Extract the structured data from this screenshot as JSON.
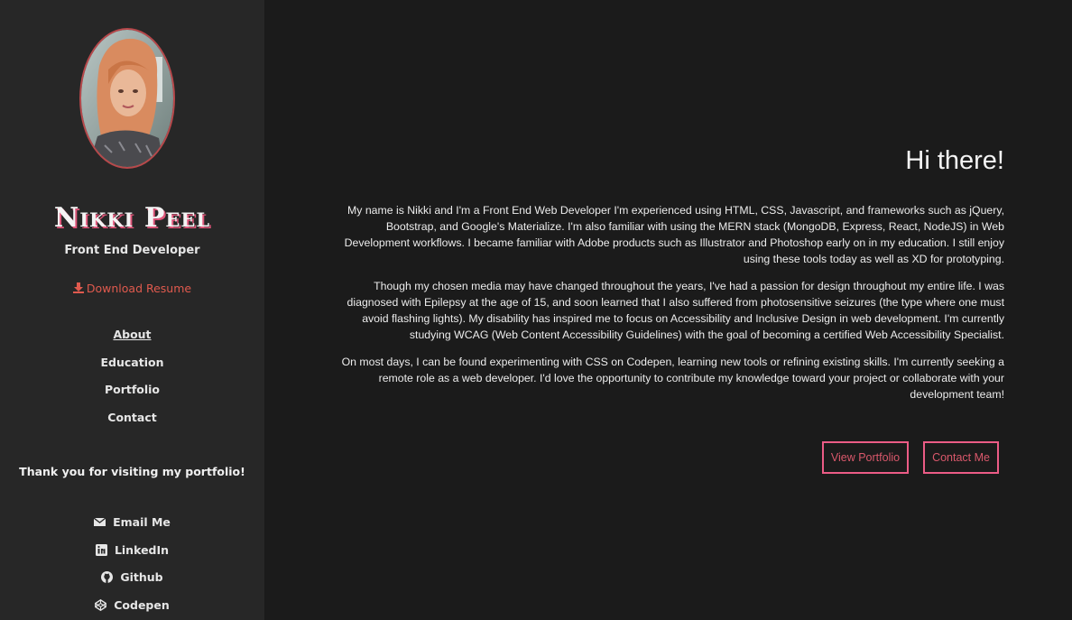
{
  "sidebar": {
    "name": "Nikki Peel",
    "role": "Front End Developer",
    "resume_label": "Download Resume",
    "resume_icon": "download-icon",
    "nav": [
      {
        "label": "About",
        "active": true
      },
      {
        "label": "Education",
        "active": false
      },
      {
        "label": "Portfolio",
        "active": false
      },
      {
        "label": "Contact",
        "active": false
      }
    ],
    "thanks": "Thank you for visiting my portfolio!",
    "social": [
      {
        "label": "Email Me",
        "icon": "envelope-icon"
      },
      {
        "label": "LinkedIn",
        "icon": "linkedin-icon"
      },
      {
        "label": "Github",
        "icon": "github-icon"
      },
      {
        "label": "Codepen",
        "icon": "codepen-icon"
      }
    ]
  },
  "main": {
    "greeting": "Hi there!",
    "paragraphs": [
      "My name is Nikki and I'm a Front End Web Developer I'm experienced using HTML, CSS, Javascript, and frameworks such as jQuery, Bootstrap, and Google's Materialize. I'm also familiar with using the MERN stack (MongoDB, Express, React, NodeJS) in Web Development workflows. I became familiar with Adobe products such as Illustrator and Photoshop early on in my education. I still enjoy using these tools today as well as XD for prototyping.",
      "Though my chosen media may have changed throughout the years, I've had a passion for design throughout my entire life. I was diagnosed with Epilepsy at the age of 15, and soon learned that I also suffered from photosensitive seizures (the type where one must avoid flashing lights). My disability has inspired me to focus on Accessibility and Inclusive Design in web development. I'm currently studying WCAG (Web Content Accessibility Guidelines) with the goal of becoming a certified Web Accessibility Specialist.",
      "On most days, I can be found experimenting with CSS on Codepen, learning new tools or refining existing skills. I'm currently seeking a remote role as a web developer. I'd love the opportunity to contribute my knowledge toward your project or collaborate with your development team!"
    ],
    "buttons": {
      "portfolio": "View Portfolio",
      "contact": "Contact Me"
    }
  },
  "colors": {
    "sidebar_bg": "#272727",
    "main_bg": "#1b1b1b",
    "accent": "#ec5c86",
    "resume": "#e05a4e"
  }
}
